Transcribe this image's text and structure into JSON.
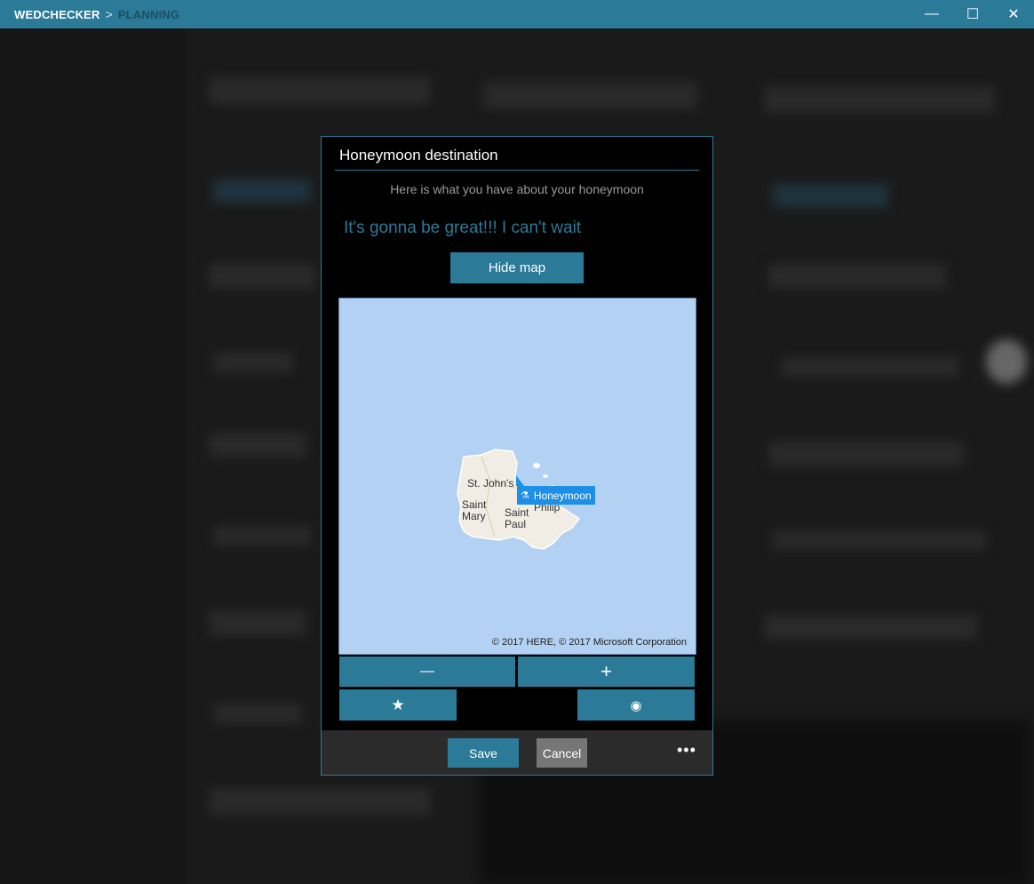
{
  "titlebar": {
    "app_name": "WEDCHECKER",
    "separator": ">",
    "section": "PLANNING",
    "minimize": "—",
    "maximize": "☐",
    "close": "✕"
  },
  "dialog": {
    "title": "Honeymoon destination",
    "subtitle": "Here is what you have about your honeymoon",
    "note": "It's gonna be great!!! I can't wait",
    "hide_map_label": "Hide map",
    "map": {
      "places": [
        "St. John's",
        "Saint Mary",
        "Saint Paul",
        "Philip"
      ],
      "pin_label": "Honeymoon",
      "copyright": "© 2017 HERE, © 2017 Microsoft Corporation"
    },
    "controls": {
      "zoom_out": "—",
      "zoom_in": "+",
      "favorite": "★",
      "locate": "◉"
    },
    "footer": {
      "save_label": "Save",
      "cancel_label": "Cancel",
      "more_label": "•••"
    }
  },
  "colors": {
    "accent": "#2b7a98",
    "map_water": "#b3d1f2",
    "pin": "#1e8fe6"
  }
}
